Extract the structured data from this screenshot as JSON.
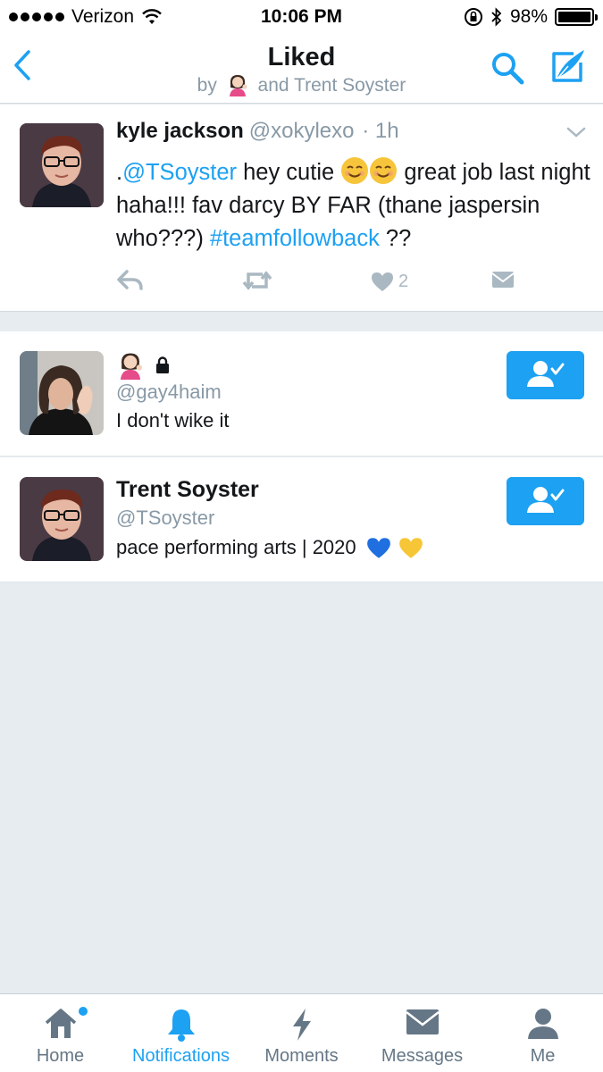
{
  "status_bar": {
    "carrier": "Verizon",
    "time": "10:06 PM",
    "battery": "98%"
  },
  "nav": {
    "title": "Liked",
    "subtitle_prefix": "by",
    "subtitle_suffix": "and Trent Soyster"
  },
  "tweet": {
    "name": "kyle jackson",
    "handle": "@xokylexo",
    "time": "· 1h",
    "text_prefix": ".",
    "mention": "@TSoyster",
    "text_part1": " hey cutie ",
    "text_part2": " great job last night haha!!! fav darcy BY FAR (thane jaspersin who???) ",
    "hashtag": "#teamfollowback",
    "text_part3": " ??",
    "like_count": "2"
  },
  "users": [
    {
      "name": "",
      "handle": "@gay4haim",
      "bio": "I don't wike it",
      "protected": true
    },
    {
      "name": "Trent Soyster",
      "handle": "@TSoyster",
      "bio": "pace performing arts | 2020"
    }
  ],
  "tabs": [
    {
      "label": "Home",
      "icon": "home-icon"
    },
    {
      "label": "Notifications",
      "icon": "bell-icon"
    },
    {
      "label": "Moments",
      "icon": "lightning-icon"
    },
    {
      "label": "Messages",
      "icon": "envelope-icon"
    },
    {
      "label": "Me",
      "icon": "person-icon"
    }
  ],
  "colors": {
    "accent": "#1da1f2",
    "background": "#e6ecf0",
    "muted": "#8899a6"
  }
}
